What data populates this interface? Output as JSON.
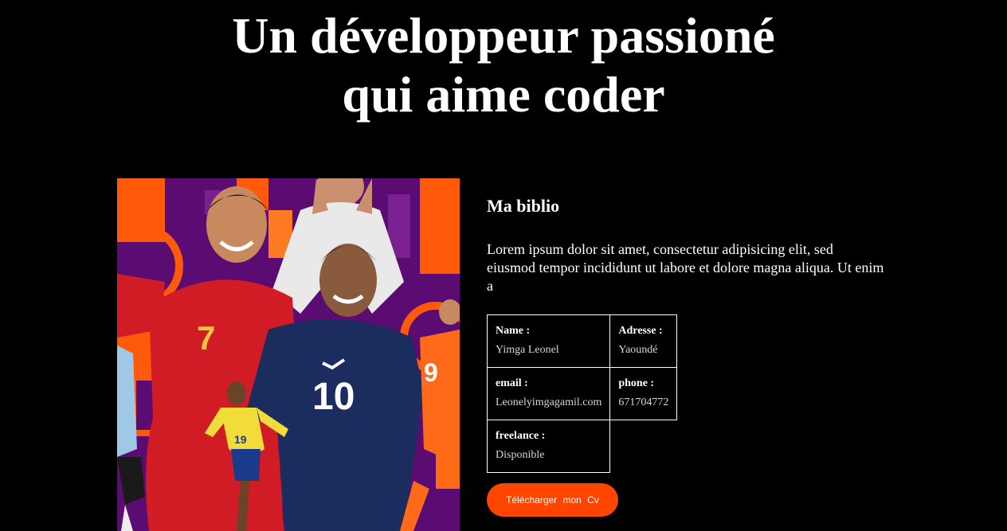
{
  "hero": {
    "title_line1": "Un développeur passioné",
    "title_line2": "qui aime coder"
  },
  "photo": {
    "icon": "football-players-image",
    "jersey_numbers": [
      "7",
      "10",
      "19",
      "9"
    ]
  },
  "about": {
    "heading": "Ma biblio",
    "text": "Lorem ipsum dolor sit amet, consectetur adipisicing elit, sed eiusmod tempor incididunt ut labore et dolore magna aliqua. Ut enim a"
  },
  "details": {
    "name_label": "Name :",
    "name_value": "Yimga Leonel",
    "address_label": "Adresse :",
    "address_value": "Yaoundé",
    "email_label": "email :",
    "email_value": "Leonelyimgagamil.com",
    "phone_label": "phone :",
    "phone_value": "671704772",
    "freelance_label": "freelance :",
    "freelance_value": "Disponible"
  },
  "cv_button": {
    "label": "Télécharger  mon  Cv"
  },
  "colors": {
    "background": "#000000",
    "accent": "#ff4500",
    "text": "#ffffff"
  }
}
